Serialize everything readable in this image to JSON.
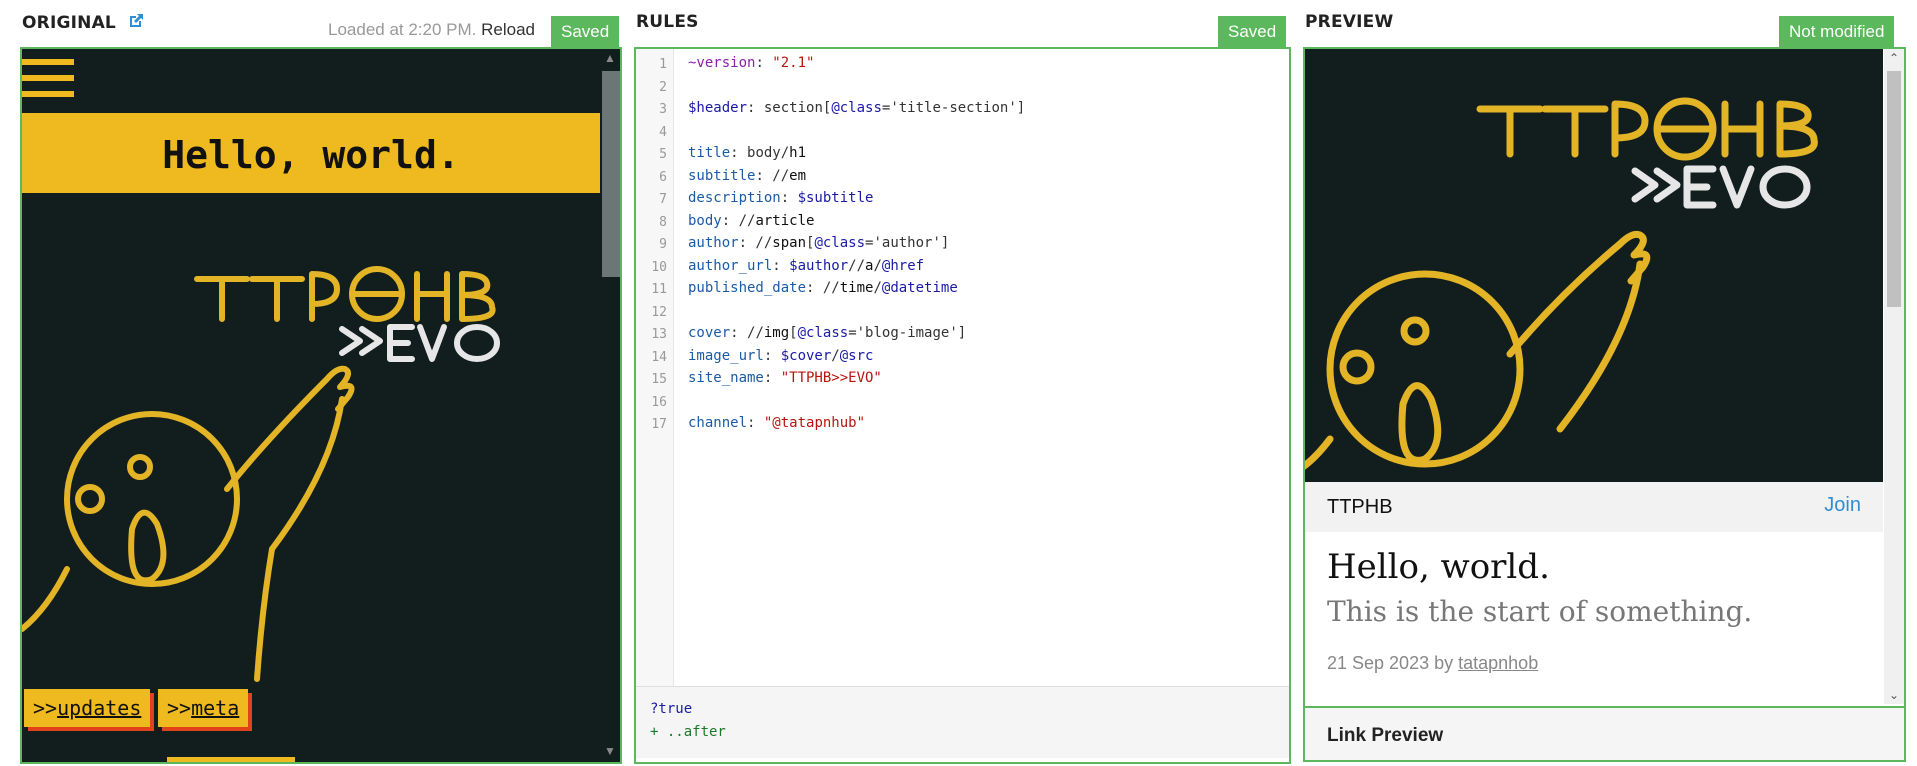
{
  "original": {
    "title": "ORIGINAL",
    "loaded_text": "Loaded at 2:20 PM.",
    "reload_label": "Reload",
    "status": "Saved",
    "hello": "Hello, world.",
    "chips": [
      {
        "prefix": ">>",
        "link": "updates"
      },
      {
        "prefix": ">>",
        "link": "meta"
      }
    ],
    "logo_lines": [
      "TTPHB",
      ">>EVO"
    ]
  },
  "rules": {
    "title": "RULES",
    "status": "Saved",
    "line_numbers": [
      "1",
      "2",
      "3",
      "4",
      "5",
      "6",
      "7",
      "8",
      "9",
      "10",
      "11",
      "12",
      "13",
      "14",
      "15",
      "16",
      "17"
    ],
    "lines": [
      "~version: \"2.1\"",
      "",
      "$header: section[@class='title-section']",
      "",
      "title: body/h1",
      "subtitle: //em",
      "description: $subtitle",
      "body: //article",
      "author: //span[@class='author']",
      "author_url: $author//a/@href",
      "published_date: //time/@datetime",
      "",
      "cover: //img[@class='blog-image']",
      "image_url: $cover/@src",
      "site_name: \"TTPHB>>EVO\"",
      "",
      "channel: \"@tatapnhub\""
    ],
    "footer": [
      "?true",
      "+ ..after"
    ]
  },
  "preview": {
    "title": "PREVIEW",
    "status": "Not modified",
    "site_name": "TTPHB",
    "join_label": "Join",
    "article_title": "Hello, world.",
    "subtitle": "This is the start of something.",
    "date": "21 Sep 2023 by",
    "author": "tatapnhob",
    "link_preview_label": "Link Preview",
    "logo_lines": [
      "TTPHB",
      ">>EVO"
    ]
  },
  "colors": {
    "accent_green": "#5cb85c",
    "brand_yellow": "#eeba1f",
    "dark_bg": "#121e1e",
    "chip_shadow": "#e0421b",
    "link_blue": "#2e8fd6"
  },
  "icons": {
    "external_link": "external-link-icon",
    "menu": "hamburger-menu-icon",
    "scroll_up": "chevron-up-icon",
    "scroll_down": "chevron-down-icon"
  }
}
